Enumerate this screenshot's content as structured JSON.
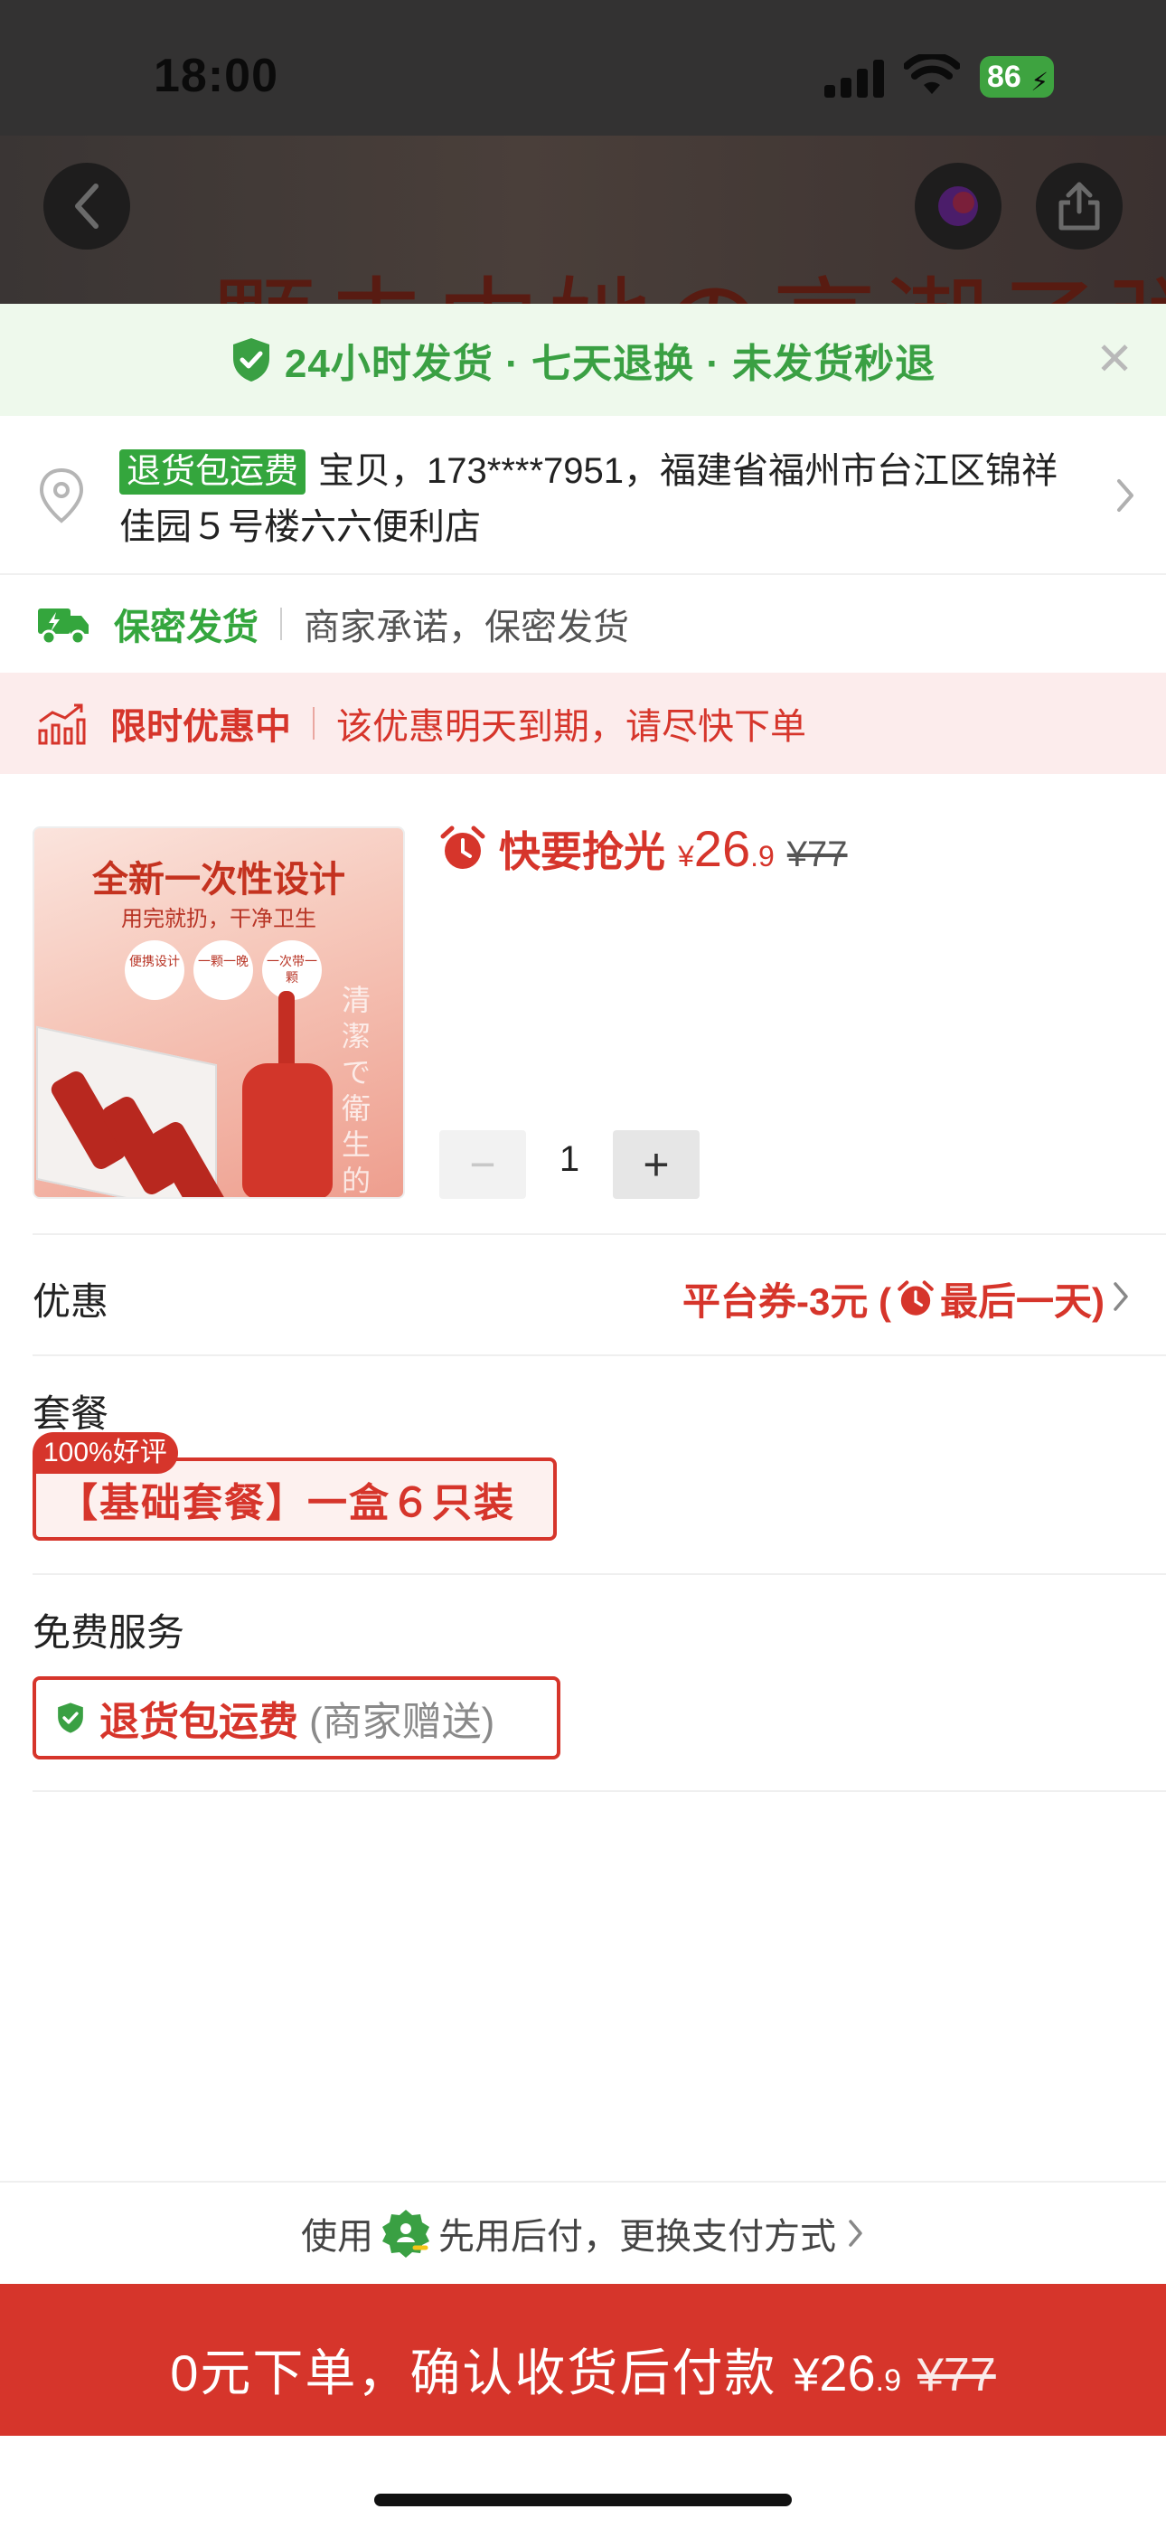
{
  "status_bar": {
    "time": "18:00",
    "battery": "86"
  },
  "banner": {
    "text": "一颗击中她の高潮子弹"
  },
  "guarantee": {
    "text": "24小时发货 · 七天退换 · 未发货秒退"
  },
  "address": {
    "tag": "退货包运费",
    "text": "宝贝，173****7951，福建省福州市台江区锦祥佳园５号楼六六便利店"
  },
  "secret": {
    "label": "保密发货",
    "desc": "商家承诺，保密发货"
  },
  "promo": {
    "label": "限时优惠中",
    "desc": "该优惠明天到期，请尽快下单"
  },
  "product": {
    "image": {
      "title": "全新一次性设计",
      "subtitle": "用完就扔，干净卫生",
      "circles": [
        "便携设计",
        "一颗一晚",
        "一次带一颗"
      ],
      "vertical_text": "清潔で衛生的"
    },
    "hot_label": "快要抢光",
    "price_symbol": "¥",
    "price_int": "26",
    "price_dec": ".9",
    "old_price": "¥77",
    "quantity": "1",
    "minus": "−",
    "plus": "+"
  },
  "discount": {
    "label": "优惠",
    "value_prefix": "平台券-3元 (",
    "value_suffix": "最后一天)"
  },
  "package": {
    "label": "套餐",
    "badge": "100%好评",
    "option": "【基础套餐】一盒６只装"
  },
  "service": {
    "label": "免费服务",
    "option": "退货包运费",
    "note": "(商家赠送)"
  },
  "paylater": {
    "prefix": "使用",
    "text": "先用后付，更换支付方式"
  },
  "cta": {
    "main": "0元下单，确认收货后付款",
    "price_symbol": "¥",
    "price_int": "26",
    "price_dec": ".9",
    "old_price": "¥77"
  },
  "colors": {
    "accent_red": "#d6352b",
    "green": "#34a63d",
    "guarantee_bg": "#eef9ec",
    "promo_bg": "#fcecec"
  }
}
